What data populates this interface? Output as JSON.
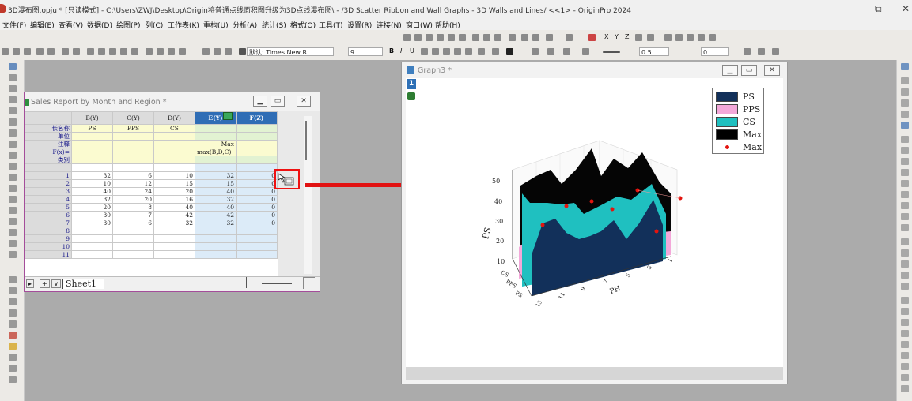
{
  "app": {
    "title": "3D瀑布图.opju * [只读模式] - C:\\Users\\ZWJ\\Desktop\\Origin将普通点线面积图升级为3D点线瀑布图\\ - /3D Scatter Ribbon and Wall Graphs - 3D Walls and Lines/ <<1> - OriginPro 2024",
    "minimize": "—",
    "restore": "⧉",
    "close": "✕"
  },
  "menu": [
    "文件(F)",
    "编辑(E)",
    "查看(V)",
    "数据(D)",
    "绘图(P)",
    "列(C)",
    "工作表(K)",
    "重构(U)",
    "分析(A)",
    "统计(S)",
    "格式(O)",
    "工具(T)",
    "设置(R)",
    "连接(N)",
    "窗口(W)",
    "帮助(H)"
  ],
  "toolbar": {
    "font": "默认: Times New R",
    "font_size": "9",
    "line_width": "0.5",
    "pattern_value": "0",
    "bold": "B",
    "italic": "I",
    "underline": "U",
    "axis_x": "X",
    "axis_y": "Y",
    "axis_z": "Z"
  },
  "workbook": {
    "title": "Sales Report by Month and Region *",
    "columns": [
      "B(Y)",
      "C(Y)",
      "D(Y)",
      "E(Y)",
      "F(Z)"
    ],
    "meta_rows": [
      {
        "label": "长名称",
        "cells": [
          "PS",
          "PPS",
          "CS",
          "",
          ""
        ]
      },
      {
        "label": "单位",
        "cells": [
          "",
          "",
          "",
          "",
          ""
        ]
      },
      {
        "label": "注释",
        "cells": [
          "",
          "",
          "",
          "Max",
          ""
        ]
      },
      {
        "label": "F(x)=",
        "cells": [
          "",
          "",
          "",
          "max(B,D,C)",
          ""
        ]
      },
      {
        "label": "类别",
        "cells": [
          "",
          "",
          "",
          "",
          ""
        ]
      }
    ],
    "rows": [
      {
        "n": "1",
        "cells": [
          "32",
          "6",
          "10",
          "32",
          "0"
        ]
      },
      {
        "n": "2",
        "cells": [
          "10",
          "12",
          "15",
          "15",
          "0"
        ]
      },
      {
        "n": "3",
        "cells": [
          "40",
          "24",
          "20",
          "40",
          "0"
        ]
      },
      {
        "n": "4",
        "cells": [
          "32",
          "20",
          "16",
          "32",
          "0"
        ]
      },
      {
        "n": "5",
        "cells": [
          "20",
          "8",
          "40",
          "40",
          "0"
        ]
      },
      {
        "n": "6",
        "cells": [
          "30",
          "7",
          "42",
          "42",
          "0"
        ]
      },
      {
        "n": "7",
        "cells": [
          "30",
          "6",
          "32",
          "32",
          "0"
        ]
      },
      {
        "n": "8",
        "cells": [
          "",
          "",
          "",
          "",
          ""
        ]
      },
      {
        "n": "9",
        "cells": [
          "",
          "",
          "",
          "",
          ""
        ]
      },
      {
        "n": "10",
        "cells": [
          "",
          "",
          "",
          "",
          ""
        ]
      },
      {
        "n": "11",
        "cells": [
          "",
          "",
          "",
          "",
          ""
        ]
      }
    ],
    "sheet_tab": "Sheet1"
  },
  "graph": {
    "title": "Graph3 *",
    "layer": "1",
    "legend": [
      {
        "label": "PS",
        "color": "#12305a",
        "kind": "box"
      },
      {
        "label": "PPS",
        "color": "#f3a8d9",
        "kind": "box"
      },
      {
        "label": "CS",
        "color": "#1fc0c0",
        "kind": "box"
      },
      {
        "label": "Max",
        "color": "#000000",
        "kind": "box"
      },
      {
        "label": "Max",
        "color": "#e3140f",
        "kind": "dot"
      }
    ],
    "z_axis_label": "PS",
    "x_axis_label": "PH",
    "z_ticks": [
      "10",
      "20",
      "30",
      "40",
      "50"
    ],
    "x_ticks": [
      "13",
      "11",
      "9",
      "7",
      "5",
      "3",
      "1"
    ],
    "y_ticks": [
      "PS",
      "PPS",
      "CS"
    ]
  },
  "colors": {
    "accent": "#e11111",
    "selected_header": "#2f6db5",
    "workbook_border": "#a44d9a"
  }
}
